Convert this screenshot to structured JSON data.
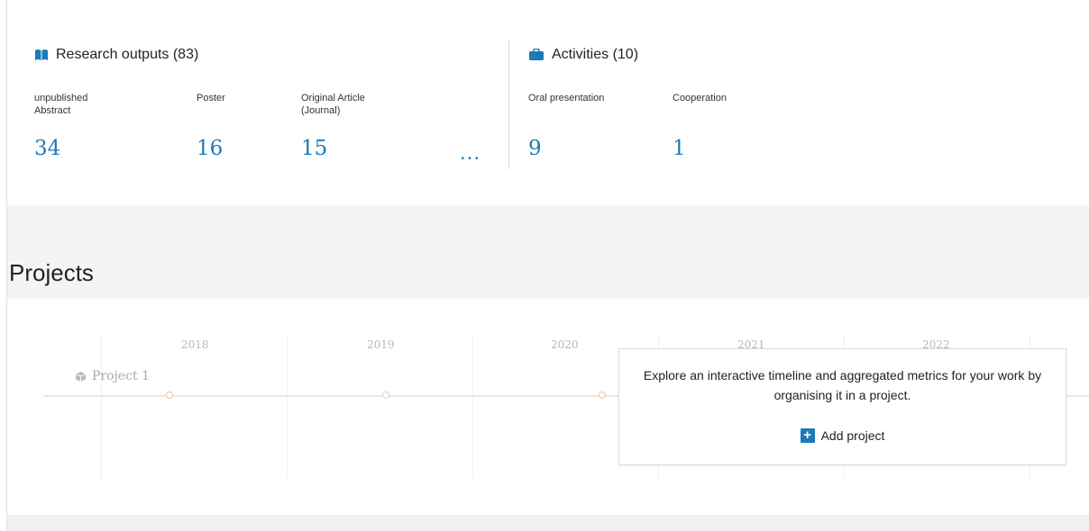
{
  "research_outputs": {
    "title": "Research outputs (83)",
    "items": [
      {
        "label": "unpublished Abstract",
        "value": "34"
      },
      {
        "label": "Poster",
        "value": "16"
      },
      {
        "label": "Original Article (Journal)",
        "value": "15"
      }
    ],
    "more": "..."
  },
  "activities": {
    "title": "Activities (10)",
    "items": [
      {
        "label": "Oral presentation",
        "value": "9"
      },
      {
        "label": "Cooperation",
        "value": "1"
      }
    ]
  },
  "projects": {
    "title": "Projects",
    "years": [
      "2018",
      "2019",
      "2020",
      "2021",
      "2022"
    ],
    "project_label": "Project 1"
  },
  "popup": {
    "message": "Explore an interactive timeline and aggregated metrics for your work by organising it in a project.",
    "add_label": "Add project"
  },
  "colors": {
    "accent": "#1a7bb8",
    "timeline_dot": "#f3c49f"
  }
}
